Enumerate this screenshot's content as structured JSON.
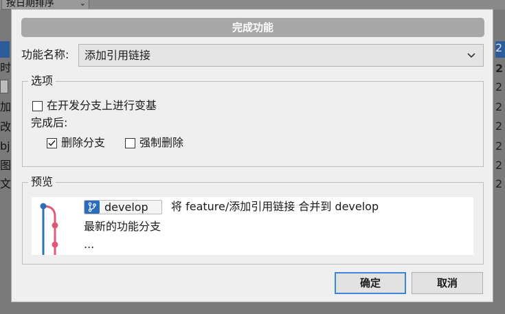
{
  "background": {
    "sort_dropdown_label": "按日期排序",
    "left_fragments": [
      "",
      "时",
      "",
      "加",
      "改",
      "bj",
      "图片",
      "文"
    ],
    "right_fragments": [
      "2",
      "2",
      "2",
      "2",
      "2",
      "2",
      "2",
      "2"
    ]
  },
  "dialog": {
    "title": "完成功能",
    "feature_name_label": "功能名称:",
    "feature_name_value": "添加引用链接",
    "options": {
      "legend": "选项",
      "rebase_label": "在开发分支上进行变基",
      "rebase_checked": false,
      "after_label": "完成后:",
      "delete_branch_label": "删除分支",
      "delete_branch_checked": true,
      "force_delete_label": "强制删除",
      "force_delete_checked": false
    },
    "preview": {
      "legend": "预览",
      "target_branch": "develop",
      "merge_description": "将 feature/添加引用链接 合并到 develop",
      "commit_message": "最新的功能分支",
      "ellipsis": "..."
    },
    "buttons": {
      "ok": "确定",
      "cancel": "取消"
    }
  },
  "colors": {
    "accent_blue": "#2a6ebb",
    "feature_line": "#e05a78",
    "develop_line": "#2f6fb6",
    "title_bar": "#a8a8a8",
    "focus_border": "#3b84d8"
  },
  "icons": {
    "dropdown": "chevron-down-icon",
    "branch": "git-branch-icon",
    "checkmark": "checkmark-icon"
  }
}
